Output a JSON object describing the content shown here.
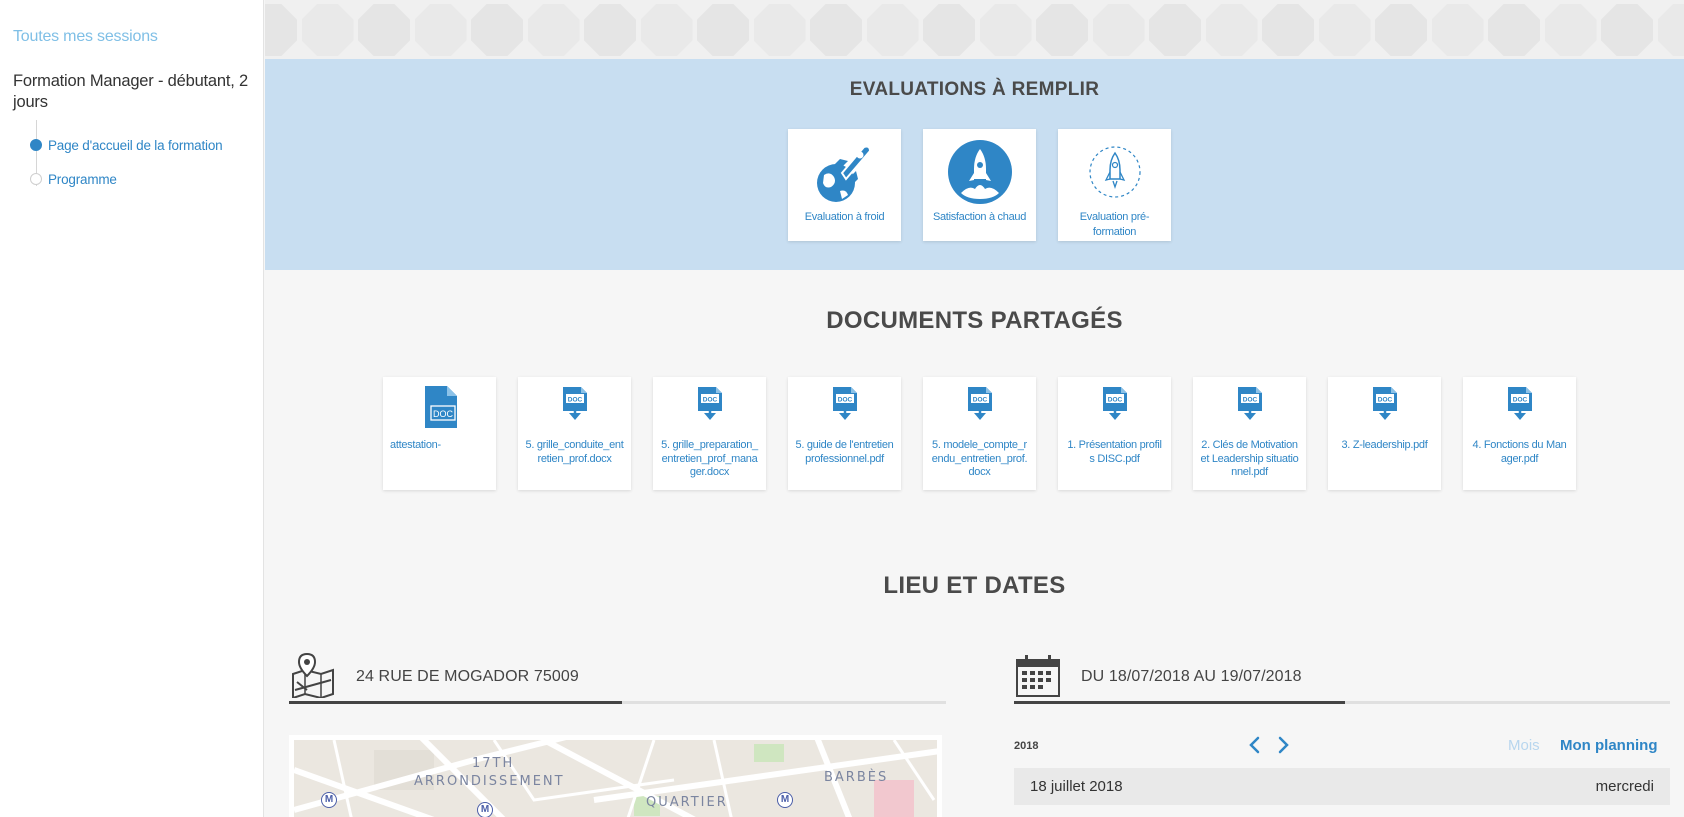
{
  "sidebar": {
    "all_sessions": "Toutes mes sessions",
    "course_title": "Formation Manager - débutant, 2 jours",
    "items": [
      {
        "label": "Page d'accueil de la formation",
        "active": true
      },
      {
        "label": "Programme",
        "active": false
      }
    ]
  },
  "evaluations": {
    "title": "EVALUATIONS À REMPLIR",
    "cards": [
      {
        "label": "Evaluation à froid",
        "icon": "rocket-globe-icon"
      },
      {
        "label": "Satisfaction à chaud",
        "icon": "rocket-launch-icon"
      },
      {
        "label": "Evaluation pré-formation",
        "icon": "rocket-outline-icon"
      }
    ]
  },
  "documents": {
    "title": "DOCUMENTS PARTAGÉS",
    "items": [
      {
        "label": "attestation-",
        "icon": "doc-file-icon"
      },
      {
        "label": "5. grille_conduite_entretien_prof.docx",
        "icon": "doc-download-icon"
      },
      {
        "label": "5. grille_preparation_entretien_prof_manager.docx",
        "icon": "doc-download-icon"
      },
      {
        "label": "5. guide de l'entretien professionnel.pdf",
        "icon": "doc-download-icon"
      },
      {
        "label": "5. modele_compte_rendu_entretien_prof.docx",
        "icon": "doc-download-icon"
      },
      {
        "label": "1. Présentation profils DISC.pdf",
        "icon": "doc-download-icon"
      },
      {
        "label": "2. Clés de Motivation et Leadership situationnel.pdf",
        "icon": "doc-download-icon"
      },
      {
        "label": "3. Z-leadership.pdf",
        "icon": "doc-download-icon"
      },
      {
        "label": "4. Fonctions du Manager.pdf",
        "icon": "doc-download-icon"
      }
    ]
  },
  "lieu": {
    "title": "LIEU ET DATES",
    "address": "24 RUE DE MOGADOR 75009",
    "dates": "DU 18/07/2018 AU 19/07/2018",
    "map": {
      "label_arr_1": "17TH",
      "label_arr_2": "ARRONDISSEMENT",
      "label_quartier": "QUARTIER",
      "label_barbes": "BARBÈS",
      "metro_symbol": "M"
    }
  },
  "calendar": {
    "year": "2018",
    "view_month": "Mois",
    "view_planning": "Mon planning",
    "rows": [
      {
        "date": "18 juillet 2018",
        "weekday": "mercredi"
      }
    ]
  },
  "colors": {
    "accent": "#2f86c6",
    "eval_band": "#c8def1",
    "muted_link": "#7fbfe6"
  }
}
